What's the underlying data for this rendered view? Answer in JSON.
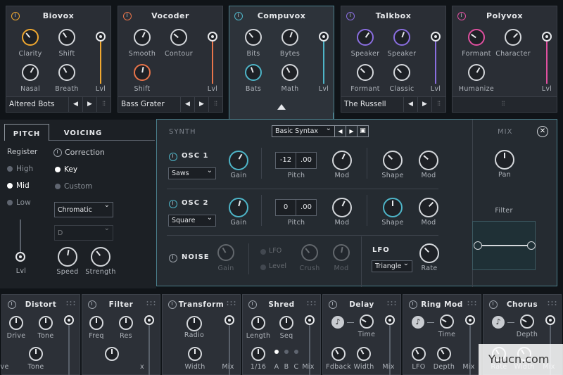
{
  "modules": [
    {
      "title": "Biovox",
      "knobs": [
        "Clarity",
        "Shift",
        "Nasal",
        "Breath"
      ],
      "slider": "Lvl",
      "preset": "Altered Bots",
      "color": "#f0a830"
    },
    {
      "title": "Vocoder",
      "knobs": [
        "Smooth",
        "Contour",
        "Shift"
      ],
      "slider": "Lvl",
      "preset": "Bass Grater",
      "color": "#e8744a"
    },
    {
      "title": "Compuvox",
      "knobs": [
        "Bits",
        "Bytes",
        "Bats",
        "Math"
      ],
      "slider": "Lvl",
      "color": "#4eb5c8"
    },
    {
      "title": "Talkbox",
      "knobs": [
        "Speaker",
        "Speaker",
        "Formant",
        "Classic"
      ],
      "slider": "Lvl",
      "preset": "The Russell",
      "color": "#8a6ee0"
    },
    {
      "title": "Polyvox",
      "knobs": [
        "Formant",
        "Character",
        "Humanize"
      ],
      "slider": "Lvl",
      "color": "#e050a0"
    }
  ],
  "left": {
    "tab_pitch": "PITCH",
    "tab_voicing": "VOICING",
    "register": "Register",
    "high": "High",
    "mid": "Mid",
    "low": "Low",
    "lvl": "Lvl",
    "correction": "Correction",
    "key": "Key",
    "custom": "Custom",
    "scale": "Chromatic",
    "root": "D",
    "speed": "Speed",
    "strength": "Strength"
  },
  "synth": {
    "section": "SYNTH",
    "preset": "Basic Syntax",
    "mix": "MIX",
    "osc1": "OSC 1",
    "osc1_wave": "Saws",
    "osc2": "OSC 2",
    "osc2_wave": "Square",
    "gain": "Gain",
    "pitch": "Pitch",
    "mod": "Mod",
    "shape": "Shape",
    "osc1_semi": "-12",
    "osc1_fine": ".00",
    "osc2_semi": "0",
    "osc2_fine": ".00",
    "noise": "NOISE",
    "lfo_opt": "LFO",
    "level_opt": "Level",
    "crush": "Crush",
    "lfo": "LFO",
    "lfo_shape": "Triangle",
    "rate": "Rate",
    "pan": "Pan",
    "filter": "Filter"
  },
  "fx": [
    {
      "title": "Distort",
      "labels": [
        "Drive",
        "Tone",
        "rive",
        "Tone"
      ]
    },
    {
      "title": "Filter",
      "labels": [
        "Freq",
        "Res",
        "x"
      ]
    },
    {
      "title": "Transform",
      "labels": [
        "Radio",
        "Width",
        "Mix"
      ]
    },
    {
      "title": "Shred",
      "labels": [
        "Length",
        "Seq",
        "1/16",
        "A",
        "B",
        "C",
        "Mix"
      ]
    },
    {
      "title": "Delay",
      "labels": [
        "Time",
        "Fdback",
        "Width",
        "Mix"
      ]
    },
    {
      "title": "Ring Mod",
      "labels": [
        "Time",
        "LFO",
        "Depth",
        "Mix"
      ]
    },
    {
      "title": "Chorus",
      "labels": [
        "Depth",
        "Rate",
        "Width",
        "Mix"
      ]
    }
  ],
  "watermark": "Yuucn.com"
}
